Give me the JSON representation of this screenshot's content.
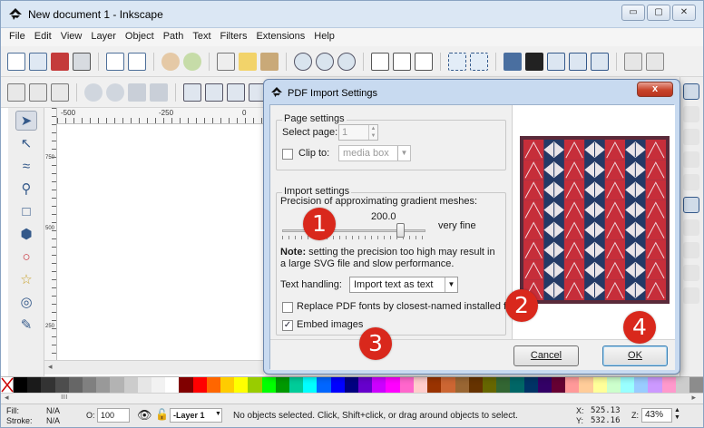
{
  "window": {
    "title": "New document 1 - Inkscape",
    "controls": {
      "minimize": "▭",
      "maximize": "▢",
      "close": "✕"
    }
  },
  "menubar": {
    "items": [
      {
        "label": "File"
      },
      {
        "label": "Edit"
      },
      {
        "label": "View"
      },
      {
        "label": "Layer"
      },
      {
        "label": "Object"
      },
      {
        "label": "Path"
      },
      {
        "label": "Text"
      },
      {
        "label": "Filters"
      },
      {
        "label": "Extensions"
      },
      {
        "label": "Help"
      }
    ]
  },
  "ruler": {
    "h_labels": [
      "-500",
      "-250",
      "0"
    ],
    "v_labels": [
      "750",
      "500",
      "250"
    ]
  },
  "dialog": {
    "title": "PDF Import Settings",
    "close_label": "x",
    "page_settings": {
      "group_label": "Page settings",
      "select_page_label": "Select page:",
      "select_page_value": "1",
      "clip_to_label": "Clip to:",
      "clip_to_checked": false,
      "clip_to_value": "media box"
    },
    "import_settings": {
      "group_label": "Import settings",
      "precision_label": "Precision of approximating gradient meshes:",
      "precision_value": "200.0",
      "precision_text": "very fine",
      "slider_fraction": 0.82,
      "note_bold": "Note:",
      "note_text": " setting the precision too high may result in a large SVG file and slow performance.",
      "text_handling_label": "Text handling:",
      "text_handling_value": "Import text as text",
      "replace_fonts_label": "Replace PDF fonts by closest-named installed fonts",
      "replace_fonts_checked": false,
      "embed_images_label": "Embed images",
      "embed_images_checked": true
    },
    "buttons": {
      "cancel": "Cancel",
      "ok": "OK"
    }
  },
  "markers": [
    "1",
    "2",
    "3",
    "4"
  ],
  "palette": {
    "colors": [
      "#000000",
      "#1a1a1a",
      "#333333",
      "#4d4d4d",
      "#666666",
      "#808080",
      "#999999",
      "#b3b3b3",
      "#cccccc",
      "#e6e6e6",
      "#f2f2f2",
      "#ffffff",
      "#800000",
      "#ff0000",
      "#ff6600",
      "#ffcc00",
      "#ffff00",
      "#99cc00",
      "#00ff00",
      "#009900",
      "#00cc99",
      "#00ffff",
      "#0066ff",
      "#0000ff",
      "#000080",
      "#6600cc",
      "#cc00ff",
      "#ff00ff",
      "#ff66cc",
      "#ffcccc",
      "#993300",
      "#cc6633",
      "#996633",
      "#663300",
      "#666600",
      "#336633",
      "#006666",
      "#003366",
      "#330066",
      "#660033",
      "#ff9999",
      "#ffcc99",
      "#ffff99",
      "#ccffcc",
      "#99ffff",
      "#99ccff",
      "#cc99ff",
      "#ff99cc",
      "#cccccc",
      "#8c8c8c"
    ]
  },
  "statusbar": {
    "fill_label": "Fill:",
    "fill_value": "N/A",
    "stroke_label": "Stroke:",
    "stroke_value": "N/A",
    "opacity_label": "O:",
    "opacity_value": "100",
    "layer_label": "-Layer 1",
    "message": "No objects selected. Click, Shift+click, or drag around objects to select.",
    "x_label": "X:",
    "x_value": "525.13",
    "y_label": "Y:",
    "y_value": "532.16",
    "zoom_label": "Z:",
    "zoom_value": "43%"
  },
  "colors": {
    "accent_blue": "#34598a",
    "marker_red": "#d9281c",
    "quilt_red": "#c62e3a",
    "quilt_navy": "#243a66"
  }
}
